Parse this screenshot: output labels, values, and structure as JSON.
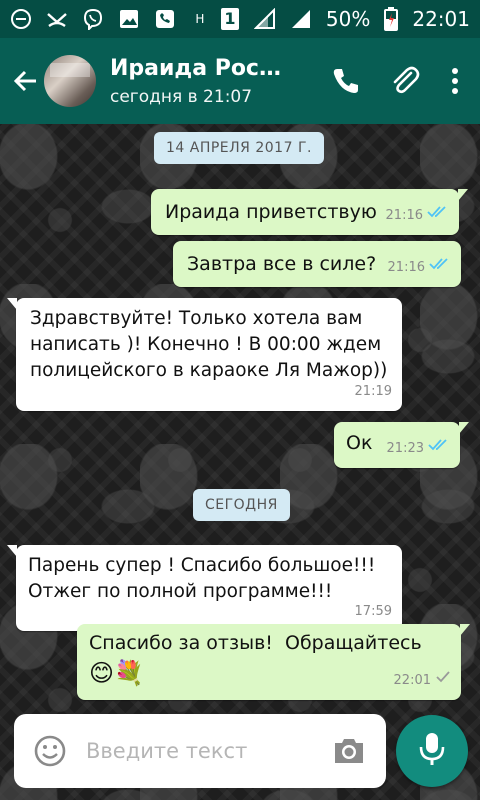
{
  "status_bar": {
    "battery_percent": "50%",
    "time": "22:01",
    "sim_slot": "1",
    "network_h": "H",
    "icons_left": [
      "minus-circle-icon",
      "missed-call-icon",
      "viber-icon",
      "image-icon",
      "phone-badge-icon"
    ],
    "icons_right": [
      "signal-icon",
      "signal-icon",
      "battery-icon"
    ]
  },
  "header": {
    "contact_name": "Ираида Рос…",
    "last_seen": "сегодня в 21:07",
    "actions": [
      "phone-icon",
      "attach-icon",
      "more-vert-icon"
    ]
  },
  "chat": {
    "date_chip_1": "14 АПРЕЛЯ 2017 Г.",
    "date_chip_2": "СЕГОДНЯ",
    "messages": [
      {
        "text": "Ираида приветствую",
        "time": "21:16",
        "direction": "out",
        "read": true
      },
      {
        "text": "Завтра все в силе?",
        "time": "21:16",
        "direction": "out",
        "read": true
      },
      {
        "text": "Здравствуйте! Только хотела вам\nнаписать )! Конечно ! В 00:00 ждем\nполицейского в караоке Ля Мажор))",
        "time": "21:19",
        "direction": "in"
      },
      {
        "text": "Ок",
        "time": "21:23",
        "direction": "out",
        "read": true
      },
      {
        "text": "Парень супер ! Спасибо большое!!!\nОтжег по полной программе!!!",
        "time": "17:59",
        "direction": "in"
      },
      {
        "text": "Спасибо за отзыв!  Обращайтесь",
        "time": "22:01",
        "direction": "out",
        "read": false,
        "emojis": "😊💐"
      }
    ]
  },
  "composer": {
    "placeholder": "Введите текст"
  },
  "colors": {
    "header": "#075e54",
    "statusbar": "#054d44",
    "out_bubble": "#dcf8c6",
    "in_bubble": "#ffffff",
    "read_tick": "#4fc3f7",
    "mic": "#128c7e"
  }
}
